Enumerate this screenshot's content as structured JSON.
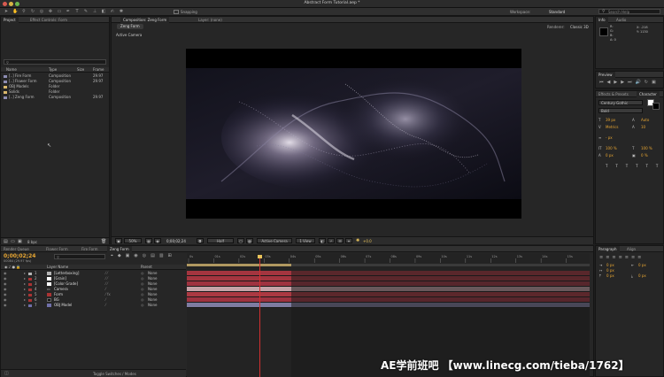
{
  "window": {
    "title": "Abstract Form Tutorial.aep *"
  },
  "toolbar": {
    "snapping_label": "Snapping",
    "workspace_label": "Workspace:",
    "workspace_value": "Standard",
    "search_help_placeholder": "Search Help"
  },
  "project_panel": {
    "tab": "Project",
    "tab2": "Effect Controls: Form",
    "search_value": "",
    "columns": {
      "name": "Name",
      "type": "Type",
      "size": "Size",
      "frame": "Frame"
    },
    "items": [
      {
        "name": "[..] Fire Form",
        "type": "Composition",
        "frame": "29.97",
        "color": "#8d8db3"
      },
      {
        "name": "[..] Flower Form",
        "type": "Composition",
        "frame": "29.97",
        "color": "#8d8db3"
      },
      {
        "name": "OBJ Models",
        "type": "Folder",
        "frame": "",
        "color": "#d9b86b"
      },
      {
        "name": "Solids",
        "type": "Folder",
        "frame": "",
        "color": "#d9b86b"
      },
      {
        "name": "[..] Zeng Form",
        "type": "Composition",
        "frame": "29.97",
        "color": "#8d8db3"
      }
    ],
    "footer_bpc": "8 bpc"
  },
  "comp_panel": {
    "tab": "Composition: Zeng Form",
    "tab2": "Layer: (none)",
    "breadcrumb": "Zeng Form",
    "renderer_label": "Renderer:",
    "renderer_value": "Classic 3D",
    "camera_label": "Active Camera",
    "zoom": "50%",
    "timecode": "0;00;02;24",
    "resolution": "Half",
    "view": "Active Camera",
    "views": "1 View",
    "exposure": "+0.0"
  },
  "info_panel": {
    "tab": "Info",
    "tab2": "Audio",
    "x": "X: -218",
    "y": "Y: 1130",
    "r": "R:",
    "g": "G:",
    "b": "B:",
    "a": "A: 0"
  },
  "preview_panel": {
    "tab": "Preview"
  },
  "effects_panel": {
    "tab": "Effects & Presets",
    "tab2": "Character"
  },
  "character_panel": {
    "font": "Century Gothic",
    "style": "Bold",
    "size": "39 px",
    "leading": "Auto",
    "kerning": "Metrics",
    "tracking": "10",
    "stroke": "- px",
    "vscale": "100 %",
    "hscale": "100 %",
    "baseline": "0 px",
    "tsume": "0 %",
    "font_label": "T"
  },
  "paragraph_panel": {
    "tab": "Paragraph",
    "tab2": "Align",
    "indent1": "0 px",
    "indent2": "0 px",
    "indent3": "0 px",
    "space1": "0 px",
    "space2": "0 px"
  },
  "timeline": {
    "tabs": [
      {
        "label": "Render Queue"
      },
      {
        "label": "Flower Form"
      },
      {
        "label": "Fire Form"
      },
      {
        "label": "Zeng Form"
      }
    ],
    "timecode": "0;00;02;24",
    "fps_label": "00084 (29.97 fps)",
    "search_value": "",
    "col_layer_name": "Layer Name",
    "col_parent": "Parent",
    "toggle_label": "Toggle Switches / Modes",
    "ruler_labels": [
      "0s",
      "01s",
      "02s",
      "03s",
      "04s",
      "05s",
      "06s",
      "07s",
      "08s",
      "09s",
      "10s",
      "11s",
      "12s",
      "13s",
      "14s",
      "15s"
    ],
    "layers": [
      {
        "num": "1",
        "name": "[Letterboxing]",
        "parent": "None",
        "bar_color": "#a4353f",
        "label_color": "#b5b5b5"
      },
      {
        "num": "2",
        "name": "[Grain]",
        "parent": "None",
        "bar_color": "#a4353f",
        "label_color": "#ffffff"
      },
      {
        "num": "3",
        "name": "[Color Grade]",
        "parent": "None",
        "bar_color": "#9f3340",
        "label_color": "#ffffff"
      },
      {
        "num": "4",
        "name": "Camera",
        "parent": "None",
        "bar_color": "#c5a3a8",
        "label_color": "#a33"
      },
      {
        "num": "5",
        "name": "Form",
        "parent": "None",
        "bar_color": "#ab3942",
        "label_color": "#a33"
      },
      {
        "num": "6",
        "name": "BG",
        "parent": "None",
        "bar_color": "#9f3340",
        "label_color": "#111"
      },
      {
        "num": "7",
        "name": "OBJ Model",
        "parent": "None",
        "bar_color": "#7e7ca1",
        "label_color": "#7070aa"
      }
    ],
    "playhead_fraction": 0.181,
    "work_area_end_fraction": 0.26
  },
  "watermark": "AE学前班吧 【www.linecg.com/tieba/1762】",
  "colors": {
    "accent_timecode": "#e8a632",
    "playhead": "#d23030",
    "work_area": "#e2c070"
  }
}
